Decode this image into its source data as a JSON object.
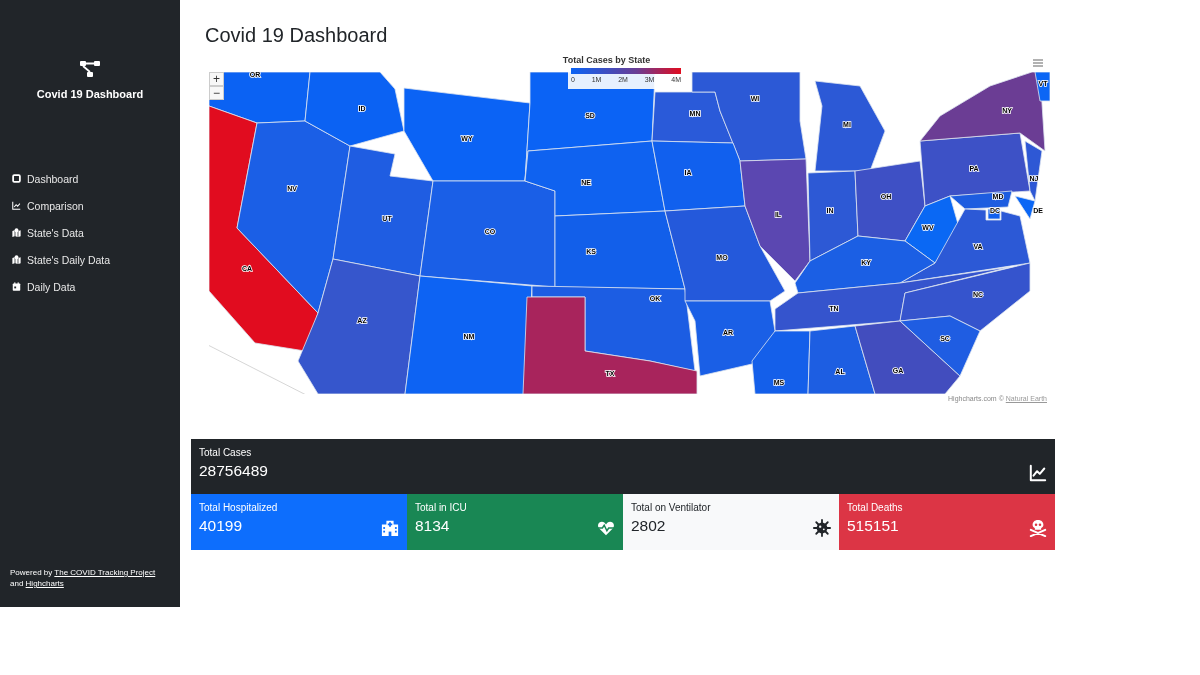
{
  "sidebar": {
    "brand": "Covid 19 Dashboard",
    "items": [
      {
        "kind": "square",
        "label": "Dashboard"
      },
      {
        "kind": "chart",
        "label": "Comparison"
      },
      {
        "kind": "map",
        "label": "State's Data"
      },
      {
        "kind": "map",
        "label": "State's Daily Data"
      },
      {
        "kind": "calendar",
        "label": "Daily Data"
      }
    ],
    "footer": {
      "prefix": "Powered by",
      "link1": "The COVID Tracking Project",
      "middle": "and",
      "link2": "Highcharts"
    }
  },
  "page_title": "Covid 19 Dashboard",
  "map": {
    "title": "Total Cases by State",
    "legend_ticks": [
      "0",
      "1M",
      "2M",
      "3M",
      "4M"
    ],
    "zoom_in": "+",
    "zoom_out": "−",
    "credit": "Highcharts.com ©",
    "credit_link": "Natural Earth",
    "states": [
      {
        "code": "OR",
        "color": "#0b62f3"
      },
      {
        "code": "CA",
        "color": "#e10c1f"
      },
      {
        "code": "NV",
        "color": "#1b5fe6"
      },
      {
        "code": "ID",
        "color": "#0b62f3"
      },
      {
        "code": "WY",
        "color": "#0b63f5"
      },
      {
        "code": "UT",
        "color": "#1f5de2"
      },
      {
        "code": "CO",
        "color": "#1a5fe7"
      },
      {
        "code": "AZ",
        "color": "#3656cc"
      },
      {
        "code": "NM",
        "color": "#0d63f3"
      },
      {
        "code": "SD",
        "color": "#0b63f5"
      },
      {
        "code": "NE",
        "color": "#0f62f0"
      },
      {
        "code": "KS",
        "color": "#125fea"
      },
      {
        "code": "OK",
        "color": "#1c5de3"
      },
      {
        "code": "TX",
        "color": "#a8245c"
      },
      {
        "code": "MN",
        "color": "#2a5ad9"
      },
      {
        "code": "WI",
        "color": "#2c59d6"
      },
      {
        "code": "IA",
        "color": "#1160ee"
      },
      {
        "code": "MO",
        "color": "#2459db"
      },
      {
        "code": "IL",
        "color": "#5b47b1"
      },
      {
        "code": "MI",
        "color": "#2c59d6"
      },
      {
        "code": "IN",
        "color": "#2d59d5"
      },
      {
        "code": "OH",
        "color": "#3e50c5"
      },
      {
        "code": "PA",
        "color": "#3d51c6"
      },
      {
        "code": "NY",
        "color": "#6b3d94"
      },
      {
        "code": "VT",
        "color": "#0b66f5"
      },
      {
        "code": "NJ",
        "color": "#2e58d5"
      },
      {
        "code": "WV",
        "color": "#0a68f4"
      },
      {
        "code": "MD",
        "color": "#1d5de0"
      },
      {
        "code": "DC",
        "color": "#1160ee"
      },
      {
        "code": "DE",
        "color": "#0a66f5"
      },
      {
        "code": "VA",
        "color": "#2c59d6"
      },
      {
        "code": "KY",
        "color": "#1b5fe4"
      },
      {
        "code": "TN",
        "color": "#3554cd"
      },
      {
        "code": "NC",
        "color": "#3554cd"
      },
      {
        "code": "AR",
        "color": "#1a5fe6"
      },
      {
        "code": "MS",
        "color": "#145fea"
      },
      {
        "code": "AL",
        "color": "#1d5ee2"
      },
      {
        "code": "GA",
        "color": "#424dbe"
      },
      {
        "code": "SC",
        "color": "#1f5de2"
      }
    ]
  },
  "summary": {
    "label": "Total Cases",
    "value": "28756489",
    "kind": "chart"
  },
  "cards": [
    {
      "label": "Total Hospitalized",
      "value": "40199",
      "kind": "hospital",
      "color": "#0d6efd"
    },
    {
      "label": "Total in ICU",
      "value": "8134",
      "kind": "heart",
      "color": "#198754"
    },
    {
      "label": "Total on Ventilator",
      "value": "2802",
      "kind": "virus",
      "color": "#f8f9fa"
    },
    {
      "label": "Total Deaths",
      "value": "515151",
      "kind": "skull",
      "color": "#dc3545"
    }
  ]
}
